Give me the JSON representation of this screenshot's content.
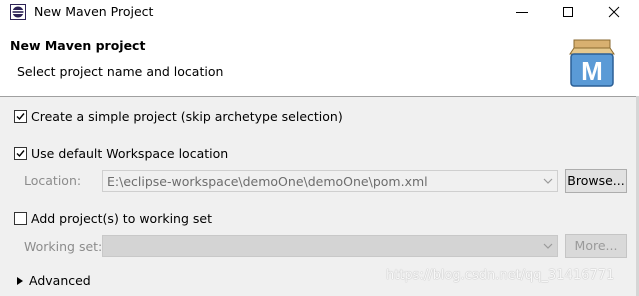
{
  "window": {
    "title": "New Maven Project",
    "icon": "eclipse-icon"
  },
  "header": {
    "title": "New Maven project",
    "subtitle": "Select project name and location",
    "logo_letter": "M"
  },
  "options": {
    "simple_project": {
      "label": "Create a simple project (skip archetype selection)",
      "checked": true
    },
    "default_workspace": {
      "label": "Use default Workspace location",
      "checked": true
    },
    "location": {
      "label": "Location:",
      "value": "E:\\eclipse-workspace\\demoOne\\demoOne\\pom.xml",
      "browse_label": "Browse..."
    },
    "working_set_check": {
      "label": "Add project(s) to working set",
      "checked": false
    },
    "working_set": {
      "label": "Working set:",
      "value": "",
      "more_label": "More..."
    },
    "advanced": {
      "label": "Advanced"
    }
  },
  "watermark": "https://blog.csdn.net/qq_31416771",
  "colors": {
    "header_bg": "#ffffff",
    "dialog_bg": "#f0f0f0",
    "maven_blue": "#3a7fc1",
    "maven_box": "#c99a4a"
  }
}
